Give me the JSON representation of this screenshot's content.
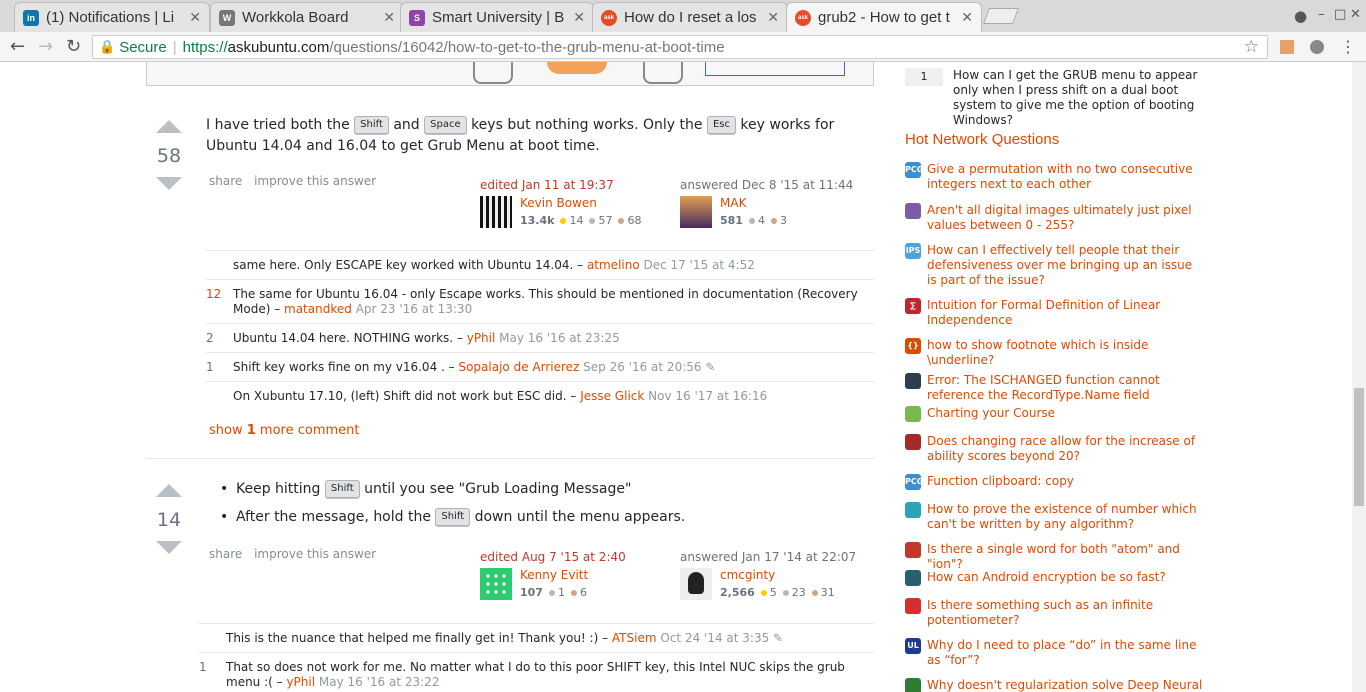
{
  "tabs": [
    {
      "title": "(1) Notifications | Li",
      "icon": "linkedin-icon",
      "color": "#0e76a8",
      "glyph": "in"
    },
    {
      "title": "Workkola Board",
      "icon": "workkola-icon",
      "color": "#777777",
      "glyph": "W"
    },
    {
      "title": "Smart University | B",
      "icon": "smart-university-icon",
      "color": "#8e44ad",
      "glyph": "S"
    },
    {
      "title": "How do I reset a los",
      "icon": "askubuntu-icon",
      "color": "#e44d26",
      "glyph": "ask"
    },
    {
      "title": "grub2 - How to get t",
      "icon": "askubuntu-icon",
      "color": "#e44d26",
      "glyph": "ask"
    }
  ],
  "address": {
    "secure": "Secure",
    "scheme": "https://",
    "host": "askubuntu.com",
    "path": "/questions/16042/how-to-get-to-the-grub-menu-at-boot-time"
  },
  "answers": [
    {
      "votes": "58",
      "body": [
        "I have tried both the ",
        "Shift",
        " and ",
        "Space",
        " keys but nothing works. Only the ",
        "Esc",
        " key works for Ubuntu 14.04 and 16.04 to get Grub Menu at boot time."
      ],
      "share": "share",
      "improve": "improve this answer",
      "edited": {
        "action": "edited Jan 11 at 19:37",
        "name": "Kevin Bowen",
        "rep": "13.4k",
        "gold": "",
        "silver": "14",
        "bronze": "57",
        "b2": "68"
      },
      "answered": {
        "action": "answered Dec 8 '15 at 11:44",
        "name": "MAK",
        "rep": "581",
        "silver": "4",
        "bronze": "3"
      },
      "comments": [
        {
          "score": "",
          "text": "same here. Only ESCAPE key worked with Ubuntu 14.04. – ",
          "user": "atmelino",
          "date": "Dec 17 '15 at 4:52"
        },
        {
          "score": "12",
          "text": "The same for Ubuntu 16.04 - only Escape works. This should be mentioned in documentation (Recovery Mode) – ",
          "user": "matandked",
          "date": "Apr 23 '16 at 13:30"
        },
        {
          "score": "2",
          "text": "Ubuntu 14.04 here. NOTHING works. – ",
          "user": "yPhil",
          "date": "May 16 '16 at 23:25"
        },
        {
          "score": "1",
          "text": "Shift key works fine on my v16.04 . – ",
          "user": "Sopalajo de Arrierez",
          "date": "Sep 26 '16 at 20:56 ✎"
        },
        {
          "score": "",
          "text": "On Xubuntu 17.10, (left) Shift did not work but ESC did. – ",
          "user": "Jesse Glick",
          "date": "Nov 16 '17 at 16:16"
        }
      ],
      "more": {
        "pre": "show ",
        "num": "1",
        "post": " more comment"
      }
    },
    {
      "votes": "14",
      "bullets": [
        [
          "Keep hitting ",
          "Shift",
          " until you see \"Grub Loading Message\""
        ],
        [
          "After the message, hold the ",
          "Shift",
          " down until the menu appears."
        ]
      ],
      "share": "share",
      "improve": "improve this answer",
      "edited": {
        "action": "edited Aug 7 '15 at 2:40",
        "name": "Kenny Evitt",
        "rep": "107",
        "silver": "1",
        "bronze": "6"
      },
      "answered": {
        "action": "answered Jan 17 '14 at 22:07",
        "name": "cmcginty",
        "rep": "2,566",
        "gold": "5",
        "silver": "23",
        "bronze": "31"
      },
      "comments": [
        {
          "score": "",
          "text": "This is the nuance that helped me finally get in! Thank you! :) – ",
          "user": "ATSiem",
          "date": "Oct 24 '14 at 3:35 ✎"
        },
        {
          "score": "1",
          "text": "That so does not work for me. No matter what I do to this poor SHIFT key, this Intel NUC skips the grub menu :( – ",
          "user": "yPhil",
          "date": "May 16 '16 at 23:22"
        }
      ]
    }
  ],
  "sidebar": {
    "linked": {
      "count": "1",
      "title": "How can I get the GRUB menu to appear only when I press shift on a dual boot system to give me the option of booting Windows?"
    },
    "hnq_title": "Hot Network Questions",
    "hnq": [
      {
        "t": "Give a permutation with no two consecutive integers next to each other",
        "icon": "puzzling-icon",
        "color": "#3c8ed0",
        "g": "PCG"
      },
      {
        "t": "Aren't all digital images ultimately just pixel values between 0 - 255?",
        "icon": "photo-icon",
        "color": "#7d5ba6",
        "g": ""
      },
      {
        "t": "How can I effectively tell people that their defensiveness over me bringing up an issue is part of the issue?",
        "icon": "interpersonal-icon",
        "color": "#4aa3df",
        "g": "IPS"
      },
      {
        "t": "Intuition for Formal Definition of Linear Independence",
        "icon": "math-icon",
        "color": "#c0262d",
        "g": "∑"
      },
      {
        "t": "how to show footnote which is inside \\underline?",
        "icon": "tex-icon",
        "color": "#dd4b00",
        "g": "{}"
      },
      {
        "t": "Error: The ISCHANGED function cannot reference the RecordType.Name field",
        "icon": "salesforce-icon",
        "color": "#2c3e50",
        "g": ""
      },
      {
        "t": "Charting your Course",
        "icon": "puzzle-icon",
        "color": "#78b84f",
        "g": ""
      },
      {
        "t": "Does changing race allow for the increase of ability scores beyond 20?",
        "icon": "rpg-icon",
        "color": "#a52a2a",
        "g": ""
      },
      {
        "t": "Function clipboard: copy",
        "icon": "codegolf-icon",
        "color": "#3c8ed0",
        "g": "PCG"
      },
      {
        "t": "How to prove the existence of number which can't be written by any algorithm?",
        "icon": "cs-icon",
        "color": "#2aa5b8",
        "g": ""
      },
      {
        "t": "Is there a single word for both \"atom\" and \"ion\"?",
        "icon": "english-icon",
        "color": "#c0392b",
        "g": ""
      },
      {
        "t": "How can Android encryption be so fast?",
        "icon": "security-icon",
        "color": "#2c5f6e",
        "g": ""
      },
      {
        "t": "Is there something such as an infinite potentiometer?",
        "icon": "electronics-icon",
        "color": "#d32f2f",
        "g": ""
      },
      {
        "t": "Why do I need to place “do” in the same line as “for”?",
        "icon": "unix-icon",
        "color": "#1f3a93",
        "g": "UL"
      },
      {
        "t": "Why doesn't regularization solve Deep Neural",
        "icon": "stats-icon",
        "color": "#2e7d32",
        "g": ""
      }
    ]
  }
}
